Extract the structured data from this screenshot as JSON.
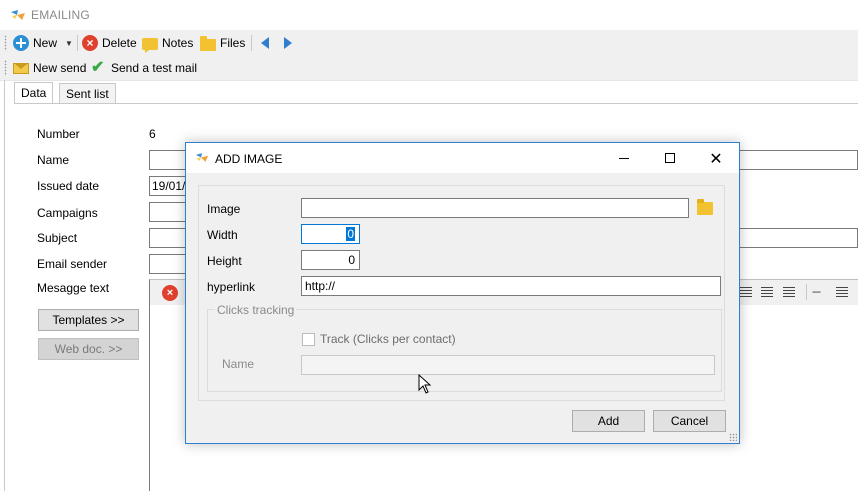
{
  "window": {
    "title": "EMAILING",
    "icon": "app-logo-icon"
  },
  "toolbar_main": {
    "new_label": "New",
    "delete_label": "Delete",
    "notes_label": "Notes",
    "files_label": "Files"
  },
  "toolbar_send": {
    "new_send_label": "New send",
    "test_mail_label": "Send a test mail"
  },
  "tabs": [
    {
      "label": "Data",
      "active": true
    },
    {
      "label": "Sent list",
      "active": false
    }
  ],
  "form": {
    "number_label": "Number",
    "number_value": "6",
    "name_label": "Name",
    "name_value": "",
    "issued_date_label": "Issued date",
    "issued_date_value": "19/01/",
    "campaigns_label": "Campaigns",
    "campaigns_value": "",
    "subject_label": "Subject",
    "subject_value": "",
    "email_sender_label": "Email sender",
    "email_sender_value": "",
    "message_text_label": "Mesagge text",
    "templates_button": "Templates >>",
    "web_doc_button": "Web doc. >>"
  },
  "dialog": {
    "title": "ADD IMAGE",
    "image_label": "Image",
    "image_value": "",
    "width_label": "Width",
    "width_value": "0",
    "height_label": "Height",
    "height_value": "0",
    "hyperlink_label": "hyperlink",
    "hyperlink_value": "http://",
    "clicks_tracking_label": "Clicks tracking",
    "track_label": "Track (Clicks per contact)",
    "track_checked": false,
    "name_label": "Name",
    "name_value": "",
    "add_button": "Add",
    "cancel_button": "Cancel"
  },
  "colors": {
    "accent": "#0078d7",
    "dialog_border": "#2f7fd0",
    "toolbar_bg": "#f0f0f0",
    "delete_red": "#e0402e",
    "new_blue": "#2b8fd8",
    "folder_yellow": "#f2c230"
  }
}
